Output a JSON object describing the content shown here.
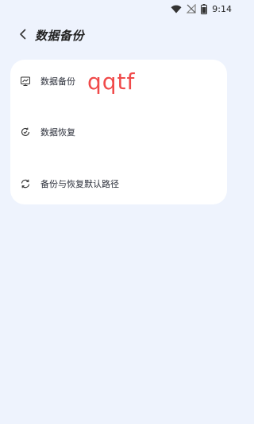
{
  "status": {
    "time": "9:14"
  },
  "header": {
    "title": "数据备份"
  },
  "menu": {
    "items": [
      {
        "label": "数据备份"
      },
      {
        "label": "数据恢复"
      },
      {
        "label": "备份与恢复默认路径"
      }
    ]
  },
  "overlay": {
    "text": "qqtf"
  }
}
